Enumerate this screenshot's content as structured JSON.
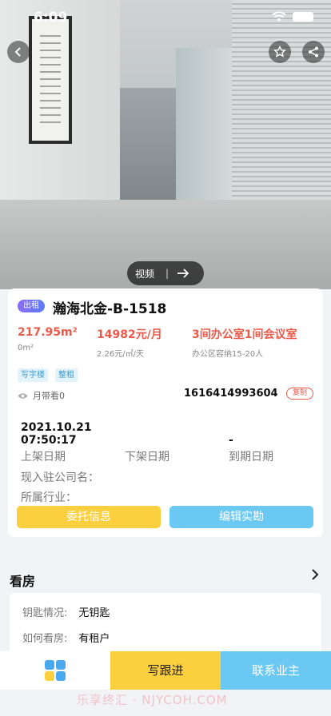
{
  "status_bar": {
    "time": "6:09"
  },
  "hero": {
    "video_label": "视频"
  },
  "listing": {
    "type_tag": "出租",
    "title": "瀚海北金-B-1518",
    "area": "217.95m²",
    "area_sub": "0m²",
    "price": "14982元/月",
    "price_sub": "2.26元/㎡/天",
    "layout": "3间办公室1间会议室",
    "layout_sub": "办公区容纳15-20人",
    "tags": [
      "写字楼",
      "整租"
    ],
    "views": "月带看0",
    "code": "1616414993604",
    "copy_label": "复制",
    "listed_date_line1": "2021.10.21",
    "listed_date_line2": "07:50:17",
    "listed_label": "上架日期",
    "delisted_label": "下架日期",
    "expiry_value": "-",
    "expiry_label": "到期日期",
    "company_label": "现入驻公司名：",
    "industry_label": "所属行业：",
    "entrust_button": "委托信息",
    "edit_button": "编辑实勘"
  },
  "viewing": {
    "title": "看房",
    "key_label": "钥匙情况:",
    "key_value": "无钥匙",
    "method_label": "如何看房:",
    "method_value": "有租户"
  },
  "bottom_bar": {
    "follow_label": "写跟进",
    "contact_label": "联系业主"
  },
  "watermark": "乐享终汇 · NJYCOH.COM",
  "colors": {
    "accent_red": "#e85a4a",
    "yellow": "#fccf3f",
    "blue": "#6bc8f3",
    "tag_blue": "#3a9bd5"
  }
}
